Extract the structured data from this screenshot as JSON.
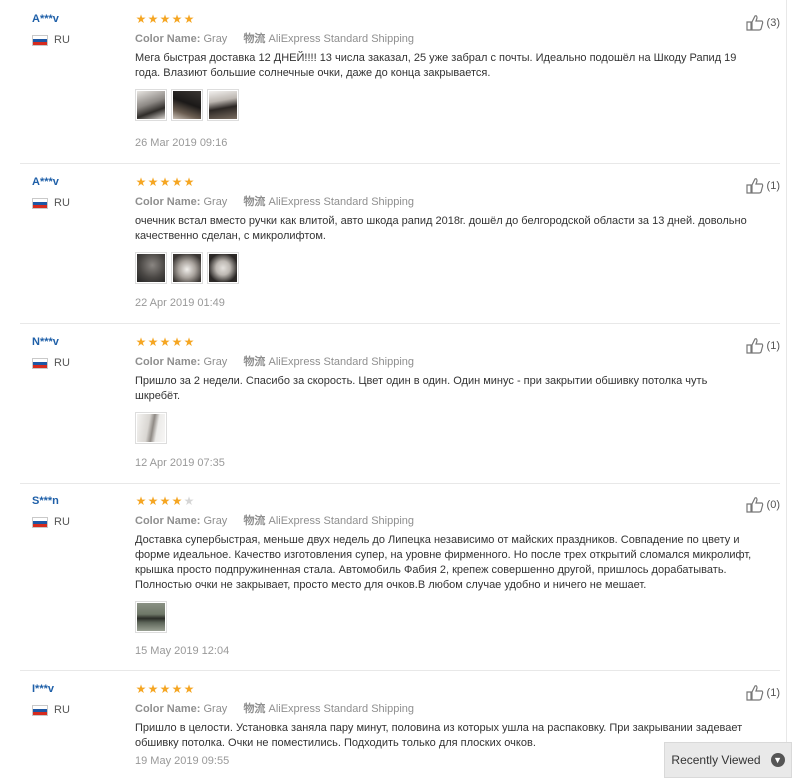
{
  "colors": {
    "username": "#1e5fa8",
    "star_on": "#f5a623",
    "star_off": "#d6d6d6",
    "muted": "#8f8f8f"
  },
  "labels": {
    "color_name": "Color Name:",
    "shipping_label": "物流",
    "shipping_method": "AliExpress Standard Shipping"
  },
  "reviews": [
    {
      "user": "A***v",
      "country": "RU",
      "rating": 5,
      "color": "Gray",
      "text": "Мега быстрая доставка 12 ДНЕЙ!!!! 13 числа заказал, 25 уже забрал с почты. Идеально подошёл на Шкоду Рапид 19 года. Влазиют большие солнечные очки, даже до конца закрывается.",
      "photos": 3,
      "date": "26 Mar 2019 09:16",
      "helpful": "(3)"
    },
    {
      "user": "A***v",
      "country": "RU",
      "rating": 5,
      "color": "Gray",
      "text": "очечник встал вместо ручки как влитой, авто шкода рапид 2018г. дошёл до белгородской области за 13 дней. довольно качественно сделан, с микролифтом.",
      "photos": 3,
      "date": "22 Apr 2019 01:49",
      "helpful": "(1)"
    },
    {
      "user": "N***v",
      "country": "RU",
      "rating": 5,
      "color": "Gray",
      "text": "Пришло за 2 недели. Спасибо за скорость. Цвет один в один. Один минус - при закрытии обшивку потолка чуть шкребёт.",
      "photos": 1,
      "date": "12 Apr 2019 07:35",
      "helpful": "(1)"
    },
    {
      "user": "S***n",
      "country": "RU",
      "rating": 4,
      "color": "Gray",
      "text": "Доставка супербыстрая, меньше двух недель до Липецка независимо от майских праздников. Совпадение по цвету и форме идеальное. Качество изготовления супер, на уровне фирменного. Но после трех открытий сломался микролифт, крышка просто подпружиненная стала. Автомобиль Фабия 2, крепеж совершенно другой, пришлось дорабатывать. Полностью очки не закрывает, просто место для очков.В любом случае удобно и ничего не мешает.",
      "photos": 1,
      "date": "15 May 2019 12:04",
      "helpful": "(0)"
    },
    {
      "user": "I***v",
      "country": "RU",
      "rating": 5,
      "color": "Gray",
      "text": "Пришло в целости. Установка заняла пару минут, половина из которых ушла на распаковку. При закрывании задевает обшивку потолка. Очки не поместились. Подходить только для плоских очков.",
      "photos": 0,
      "date": "19 May 2019 09:55",
      "helpful": "(1)"
    }
  ],
  "recently_viewed": {
    "label": "Recently Viewed",
    "icon": "chevron-down-icon"
  }
}
